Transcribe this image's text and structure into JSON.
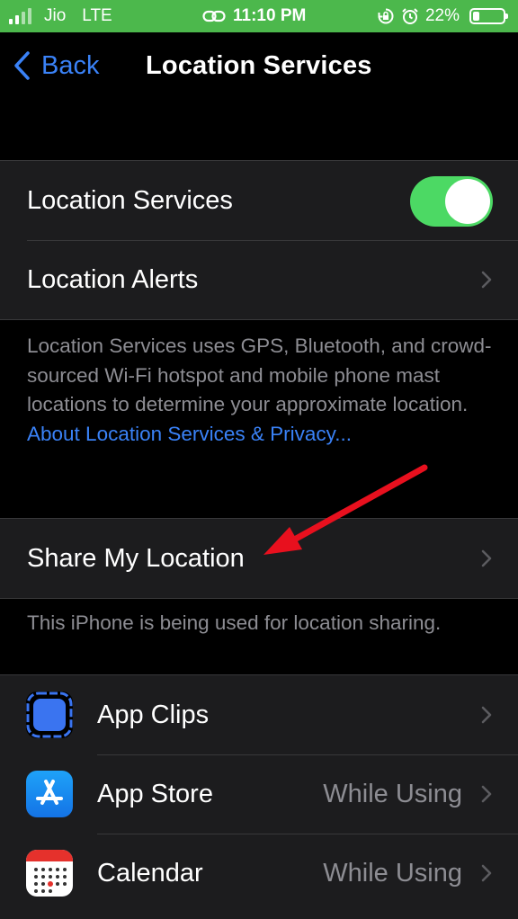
{
  "status_bar": {
    "carrier": "Jio",
    "network": "LTE",
    "time": "11:10 PM",
    "battery_percent": "22%",
    "battery_level": 0.22,
    "icons": [
      "signal-icon",
      "link-icon",
      "rotation-lock-icon",
      "alarm-icon",
      "battery-icon"
    ]
  },
  "nav": {
    "back_label": "Back",
    "title": "Location Services"
  },
  "location_group": {
    "toggle_label": "Location Services",
    "toggle_on": true,
    "alerts_label": "Location Alerts"
  },
  "description": {
    "text": "Location Services uses GPS, Bluetooth, and crowd-sourced Wi-Fi hotspot and mobile phone mast locations to determine your approximate location. ",
    "link": "About Location Services & Privacy..."
  },
  "share": {
    "label": "Share My Location",
    "footer": "This iPhone is being used for location sharing."
  },
  "apps": [
    {
      "name": "App Clips",
      "value": "",
      "icon": "app-clips-icon"
    },
    {
      "name": "App Store",
      "value": "While Using",
      "icon": "app-store-icon"
    },
    {
      "name": "Calendar",
      "value": "While Using",
      "icon": "calendar-icon"
    }
  ],
  "colors": {
    "status_bar": "#4cb84c",
    "accent": "#3a82f7",
    "toggle_on": "#4cd964",
    "annotation_arrow": "#e8101e",
    "cell_background": "#1c1c1e",
    "secondary_text": "#8d8d93"
  }
}
